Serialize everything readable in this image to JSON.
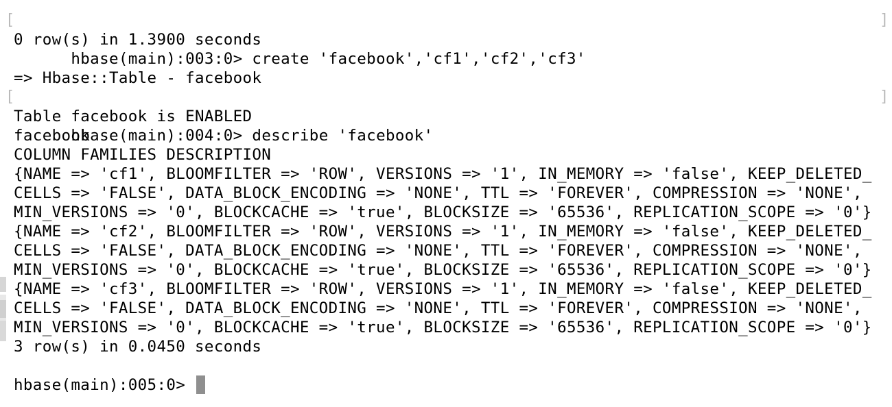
{
  "terminal": {
    "lines": [
      "hbase(main):003:0> create 'facebook','cf1','cf2','cf3'",
      "0 row(s) in 1.3900 seconds",
      "",
      "=> Hbase::Table - facebook",
      "hbase(main):004:0> describe 'facebook'",
      "Table facebook is ENABLED",
      "facebook",
      "COLUMN FAMILIES DESCRIPTION",
      "{NAME => 'cf1', BLOOMFILTER => 'ROW', VERSIONS => '1', IN_MEMORY => 'false', KEEP_DELETED_",
      "CELLS => 'FALSE', DATA_BLOCK_ENCODING => 'NONE', TTL => 'FOREVER', COMPRESSION => 'NONE',",
      "MIN_VERSIONS => '0', BLOCKCACHE => 'true', BLOCKSIZE => '65536', REPLICATION_SCOPE => '0'}",
      "{NAME => 'cf2', BLOOMFILTER => 'ROW', VERSIONS => '1', IN_MEMORY => 'false', KEEP_DELETED_",
      "CELLS => 'FALSE', DATA_BLOCK_ENCODING => 'NONE', TTL => 'FOREVER', COMPRESSION => 'NONE',",
      "MIN_VERSIONS => '0', BLOCKCACHE => 'true', BLOCKSIZE => '65536', REPLICATION_SCOPE => '0'}",
      "{NAME => 'cf3', BLOOMFILTER => 'ROW', VERSIONS => '1', IN_MEMORY => 'false', KEEP_DELETED_",
      "CELLS => 'FALSE', DATA_BLOCK_ENCODING => 'NONE', TTL => 'FOREVER', COMPRESSION => 'NONE',",
      "MIN_VERSIONS => '0', BLOCKCACHE => 'true', BLOCKSIZE => '65536', REPLICATION_SCOPE => '0'}",
      "3 row(s) in 0.0450 seconds",
      "",
      "hbase(main):005:0> "
    ],
    "bracketed_lines": [
      0,
      4
    ],
    "bracket_open": "[",
    "bracket_close": "]",
    "colors": {
      "background": "#ffffff",
      "text": "#000000",
      "cursor": "#8f8f8f",
      "bracket": "#b9b9b9"
    }
  }
}
